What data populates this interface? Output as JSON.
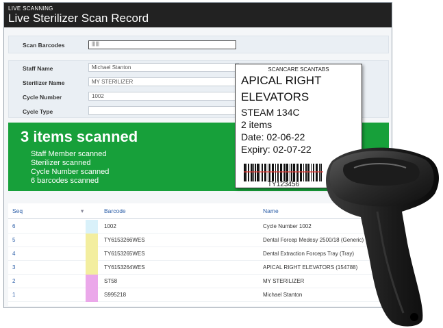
{
  "window": {
    "small_title": "LIVE SCANNING",
    "title": "Live Sterilizer Scan Record"
  },
  "scan": {
    "label": "Scan Barcodes",
    "value": "||||||"
  },
  "form": {
    "staff_label": "Staff Name",
    "staff_value": "Michael Stanton",
    "sterilizer_label": "Sterilizer Name",
    "sterilizer_value": "MY STERILIZER",
    "cycle_number_label": "Cycle Number",
    "cycle_number_value": "1002",
    "cycle_type_label": "Cycle Type",
    "cycle_type_value": ""
  },
  "status": {
    "count": "3 items scanned",
    "lines": [
      "Staff Member scanned",
      "Sterilizer scanned",
      "Cycle Number scanned",
      "6 barcodes scanned"
    ]
  },
  "table": {
    "headers": {
      "seq": "Seq",
      "sort": "▾",
      "barcode": "Barcode",
      "name": "Name"
    },
    "rows": [
      {
        "seq": "6",
        "barcode": "1002",
        "name": "Cycle Number 1002",
        "color": "#d9f1fa"
      },
      {
        "seq": "5",
        "barcode": "TY6153266WES",
        "name": "Dental Forcep Medesy 2500/18 (Generic)",
        "color": "#f3ee9f"
      },
      {
        "seq": "4",
        "barcode": "TY6153265WES",
        "name": "Dental Extraction Forceps Tray (Tray)",
        "color": "#f3ee9f"
      },
      {
        "seq": "3",
        "barcode": "TY6153264WES",
        "name": "APICAL RIGHT ELEVATORS (154788)",
        "color": "#f3ee9f"
      },
      {
        "seq": "2",
        "barcode": "ST58",
        "name": "MY STERILIZER",
        "color": "#eba8ea"
      },
      {
        "seq": "1",
        "barcode": "S995218",
        "name": "Michael Stanton",
        "color": "#eba8ea"
      }
    ]
  },
  "label_card": {
    "brand": "SCANCARE SCANTABS",
    "line1": "APICAL RIGHT",
    "line2": "ELEVATORS",
    "line3": "STEAM 134C",
    "line4": "2 items",
    "line5": "Date: 02-06-22",
    "line6": "Expiry: 02-07-22",
    "barcode_number": "TY123456"
  },
  "colors": {
    "title_bar": "#222222",
    "status_green": "#17a03a",
    "header_blue": "#2d5fa8"
  }
}
